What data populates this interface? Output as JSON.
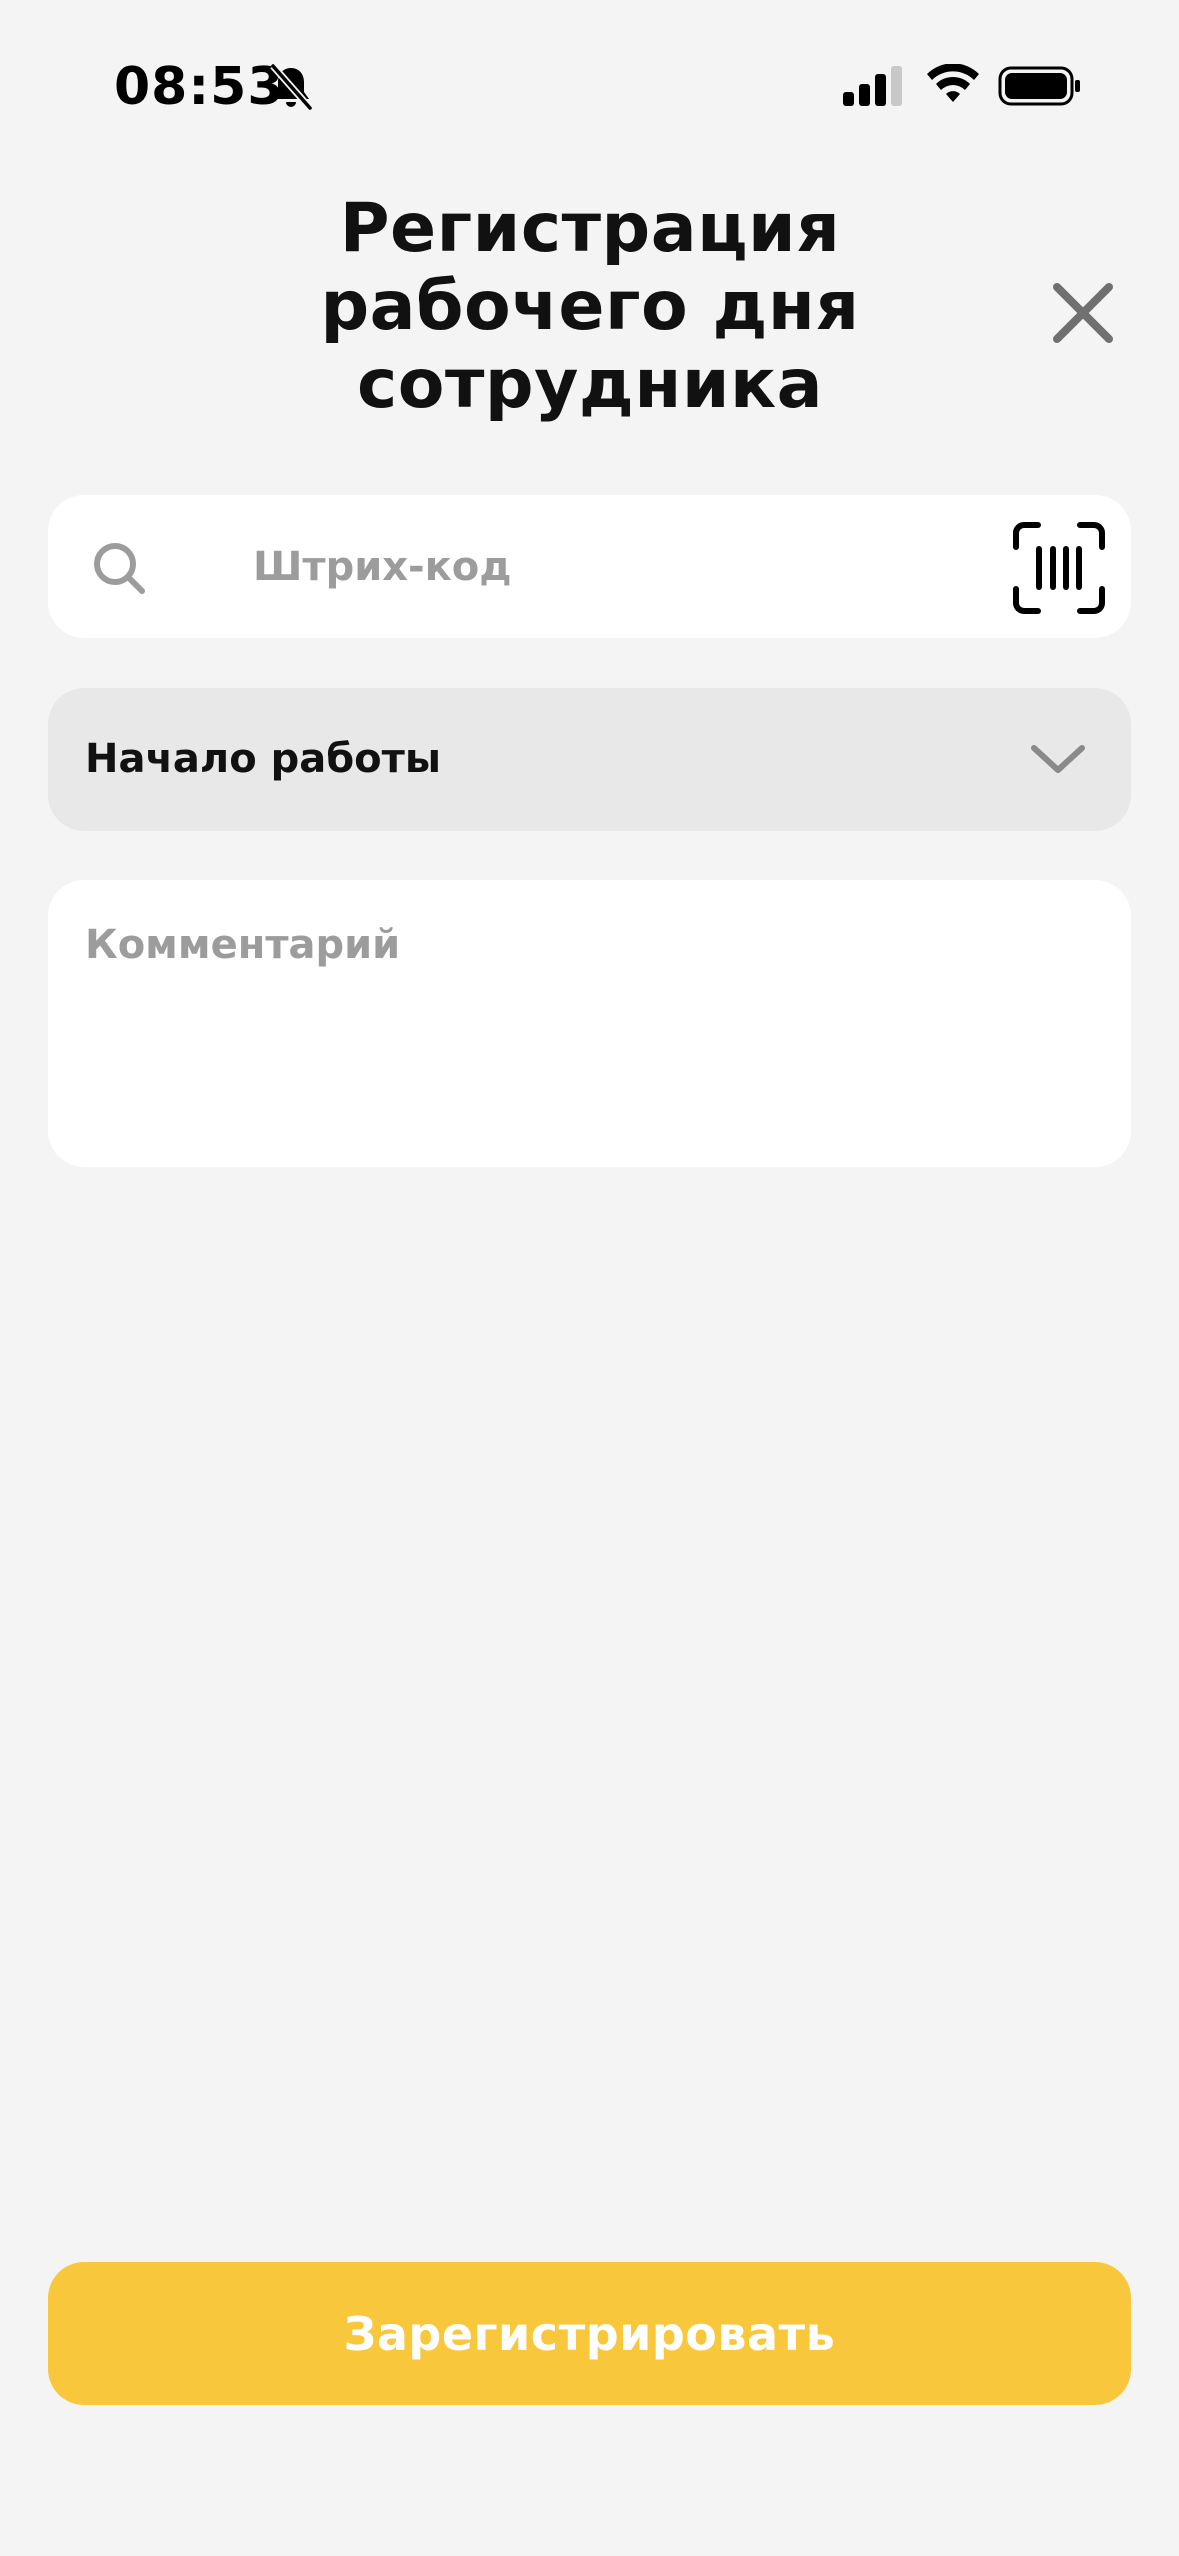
{
  "status_bar": {
    "time": "08:53",
    "icons": [
      "bell-slash-icon",
      "cellular-signal-icon",
      "wifi-icon",
      "battery-icon"
    ]
  },
  "header": {
    "title": "Регистрация рабочего дня сотрудника",
    "close_icon": "close-icon"
  },
  "search": {
    "placeholder": "Штрих-код",
    "value": "",
    "icon": "search-icon",
    "scan_icon": "barcode-scan-icon"
  },
  "work_type": {
    "selected": "Начало работы",
    "icon": "chevron-down-icon"
  },
  "comment": {
    "placeholder": "Комментарий",
    "value": ""
  },
  "actions": {
    "submit_label": "Зарегистрировать"
  },
  "colors": {
    "background": "#f4f4f4",
    "accent": "#f9c73b",
    "field_bg": "#ffffff",
    "select_bg": "#e8e8e8",
    "placeholder": "#9c9c9c"
  }
}
